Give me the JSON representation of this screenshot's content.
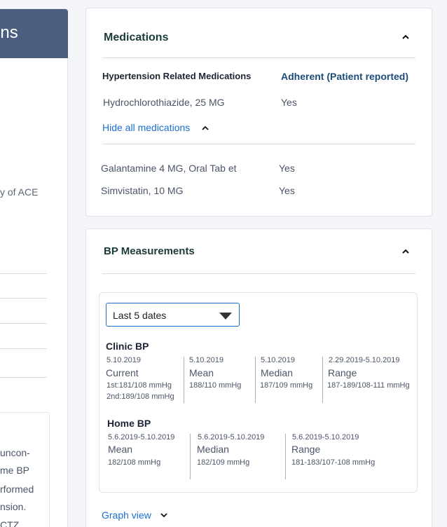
{
  "left_panel": {
    "title": "ons",
    "text_ace": "y of ACE",
    "card_lines": [
      "uncon-",
      "me BP",
      "rformed",
      "nsion.",
      "CTZ"
    ]
  },
  "medications": {
    "title": "Medications",
    "col_med": "Hypertension Related Medications",
    "col_adherent": "Adherent (Patient reported)",
    "primary": [
      {
        "name": "Hydrochlorothiazide, 25 MG",
        "adherent": "Yes"
      }
    ],
    "toggle_label": "Hide all medications",
    "others": [
      {
        "name": "Galantamine 4 MG, Oral Tab et",
        "adherent": "Yes"
      },
      {
        "name": "Simvistatin, 10 MG",
        "adherent": "Yes"
      }
    ]
  },
  "bp": {
    "title": "BP Measurements",
    "select_value": "Last 5 dates",
    "clinic": {
      "title": "Clinic BP",
      "cols": [
        {
          "date": "5.10.2019",
          "label": "Current",
          "value": "1st:181/108 mmHg",
          "value2": "2nd:189/108 mmHg"
        },
        {
          "date": "5.10.2019",
          "label": "Mean",
          "value": "188/110 mmHg"
        },
        {
          "date": "5.10.2019",
          "label": "Median",
          "value": "187/109 mmHg"
        },
        {
          "date": "2.29.2019-5.10.2019",
          "label": "Range",
          "value": "187-189/108-111 mmHg"
        }
      ]
    },
    "home": {
      "title": "Home BP",
      "cols": [
        {
          "date": "5.6.2019-5.10.2019",
          "label": "Mean",
          "value": "182/108 mmHg"
        },
        {
          "date": "5.6.2019-5.10.2019",
          "label": "Median",
          "value": "182/109 mmHg"
        },
        {
          "date": "5.6.2019-5.10.2019",
          "label": "Range",
          "value": "181-183/107-108 mmHg"
        }
      ]
    },
    "graph_link": "Graph view"
  },
  "colors": {
    "accent": "#1a6fd0",
    "header": "#4a5f7f",
    "title": "#1c3a3a"
  },
  "icons": [
    "chevron-up-icon",
    "chevron-down-icon",
    "dropdown-arrow-icon"
  ]
}
